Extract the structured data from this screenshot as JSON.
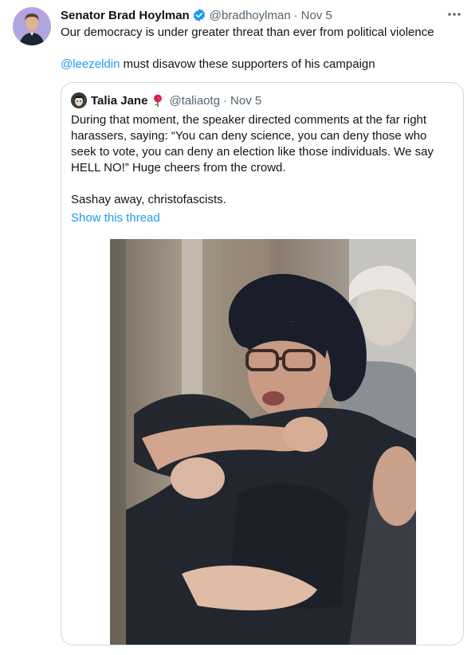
{
  "tweet": {
    "author": {
      "display_name": "Senator Brad Hoylman",
      "handle": "@bradhoylman",
      "verified": true
    },
    "separator": "·",
    "date": "Nov 5",
    "more_icon": "more-horizontal-icon",
    "text_line_1": "Our democracy is under greater threat than ever from political violence",
    "mention": "@leezeldin",
    "text_line_2": " must disavow these supporters of his campaign"
  },
  "quote": {
    "author": {
      "display_name": "Talia Jane",
      "handle": "@taliaotg",
      "emoji": "rose-emoji"
    },
    "separator": "·",
    "date": "Nov 5",
    "paragraph_1": "During that moment, the speaker directed comments at the far right harassers, saying: “You can deny science, you can deny those who seek to vote, you can deny an election like those individuals. We say HELL NO!” Huge cheers from the crowd.",
    "paragraph_2": "Sashay away, christofascists.",
    "show_thread": "Show this thread"
  },
  "colors": {
    "link": "#1d9bf0",
    "secondary_text": "#536471",
    "border": "#cfd9de",
    "avatar_bg": "#b3a6e0"
  }
}
